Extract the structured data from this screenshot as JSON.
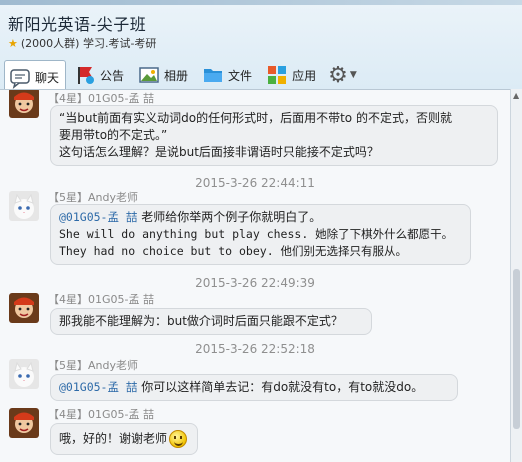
{
  "window": {
    "title": "新阳光英语-尖子班",
    "subtitle": "(2000人群) 学习.考试-考研"
  },
  "toolbar": {
    "chat_label": "聊天",
    "notice_label": "公告",
    "album_label": "相册",
    "file_label": "文件",
    "app_label": "应用"
  },
  "messages": [
    {
      "sender": "【4星】01G05-孟  喆",
      "lines": [
        "“当but前面有实义动词do的任何形式时，后面用不带to 的不定式，否则就",
        "要用带to的不定式。”",
        "这句话怎么理解？是说but后面接非谓语时只能接不定式吗？"
      ]
    },
    {
      "timestamp": "2015-3-26 22:44:11",
      "sender": "【5星】Andy老师",
      "mention": "@01G05-孟  喆",
      "first_line_rest": " 老师给你举两个例子你就明白了。",
      "lines": [
        "She will do anything but play chess. 她除了下棋外什么都愿干。",
        "They had no choice but to obey. 他们别无选择只有服从。"
      ]
    },
    {
      "timestamp": "2015-3-26 22:49:39",
      "sender": "【4星】01G05-孟  喆",
      "text": "那我能不能理解为：but做介词时后面只能跟不定式？"
    },
    {
      "timestamp": "2015-3-26 22:52:18",
      "sender": "【5星】Andy老师",
      "mention": "@01G05-孟  喆",
      "first_line_rest": " 你可以这样简单去记：有do就没有to，有to就没do。"
    },
    {
      "sender": "【4星】01G05-孟  喆",
      "text": "哦，好的！谢谢老师"
    }
  ]
}
